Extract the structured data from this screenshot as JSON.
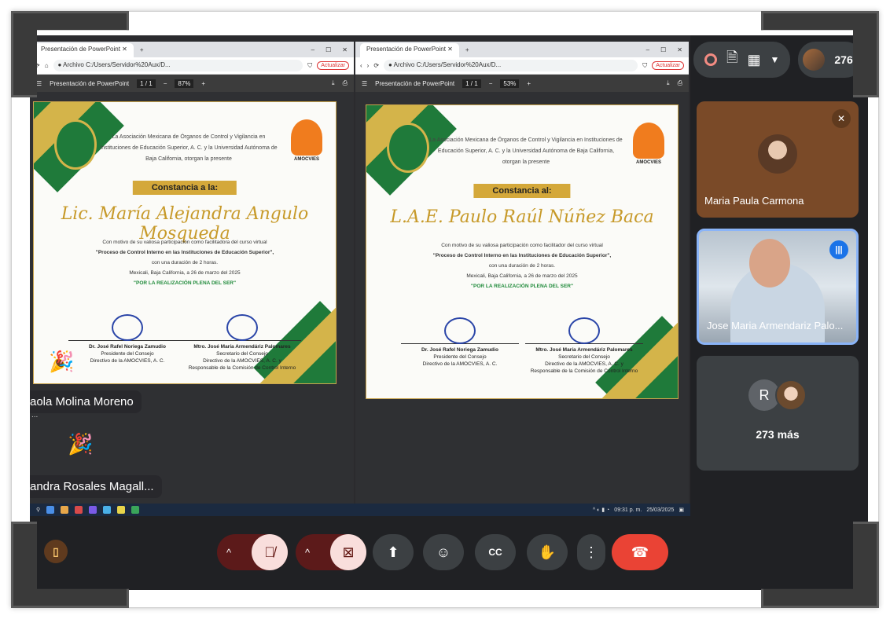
{
  "browser_left": {
    "tab_title": "Presentación de PowerPoint",
    "address_archivo": "Archivo",
    "address_path": "C:/Users/Servidor%20Aux/D...",
    "update_label": "Actualizar",
    "pdf_title": "Presentación de PowerPoint",
    "page": "1 / 1",
    "zoom": "87%"
  },
  "browser_right": {
    "tab_title": "Presentación de PowerPoint",
    "address_archivo": "Archivo",
    "address_path": "C:/Users/Servidor%20Aux/D...",
    "update_label": "Actualizar",
    "pdf_title": "Presentación de PowerPoint",
    "page": "1 / 1",
    "zoom": "53%"
  },
  "cert_left": {
    "intro": "La Asociación Mexicana de Órganos de Control y Vigilancia en Instituciones de Educación Superior, A. C. y la Universidad Autónoma de Baja California, otorgan la presente",
    "banner": "Constancia a la:",
    "recipient": "Lic. María Alejandra Angulo Mosqueda",
    "line1": "Con motivo de su valiosa participación como facilitadora del curso virtual",
    "course": "\"Proceso de Control Interno en las Instituciones de Educación Superior\",",
    "duration": "con una duración de 2 horas.",
    "place_date": "Mexicali, Baja California, a 26 de marzo del 2025",
    "motto": "\"POR LA REALIZACIÓN PLENA DEL SER\"",
    "sig1_name": "Dr. José Rafel Noriega Zamudio",
    "sig1_role1": "Presidente del Consejo",
    "sig1_role2": "Directivo de la AMOCVIES, A. C.",
    "sig2_name": "Mtro. José María Armendáriz Palomares",
    "sig2_role1": "Secretario del Consejo",
    "sig2_role2": "Directivo de la AMOCVIES, A. C. y",
    "sig2_role3": "Responsable de la Comisión de Control Interno",
    "logo_text": "AMOCVIES"
  },
  "cert_right": {
    "intro": "La Asociación Mexicana de Órganos de Control y Vigilancia en Instituciones de Educación Superior, A. C. y la Universidad Autónoma de Baja California, otorgan la presente",
    "banner": "Constancia al:",
    "recipient": "L.A.E. Paulo Raúl Núñez Baca",
    "line1": "Con motivo de su valiosa participación como facilitador del curso virtual",
    "course": "\"Proceso de Control Interno en las Instituciones de Educación Superior\",",
    "duration": "con una duración de 2 horas.",
    "place_date": "Mexicali, Baja California, a 26 de marzo del 2025",
    "motto": "\"POR LA REALIZACIÓN PLENA DEL SER\"",
    "sig1_name": "Dr. José Rafel Noriega Zamudio",
    "sig1_role1": "Presidente del Consejo",
    "sig1_role2": "Directivo de la AMOCVIES, A. C.",
    "sig2_name": "Mtro. José María Armendáriz Palomares",
    "sig2_role1": "Secretario del Consejo",
    "sig2_role2": "Directivo de la AMOCVIES, A. C. y",
    "sig2_role3": "Responsable de la Comisión de Control Interno",
    "logo_text": "AMOCVIES"
  },
  "taskbar": {
    "time": "09:31 p. m.",
    "date": "25/03/2025"
  },
  "left_labels": {
    "name1": "aola Molina Moreno",
    "name2": "andra Rosales Magall...",
    "dots": "..."
  },
  "top_controls": {
    "participant_count": "276"
  },
  "tiles": {
    "tile1_name": "Maria Paula Carmona",
    "tile2_name": "Jose Maria Armendariz Palo...",
    "tile3_initial": "R",
    "tile3_more": "273 más"
  },
  "colors": {
    "meet_bg": "#202124",
    "end_call": "#ea4335",
    "muted_bg": "#f9dedc",
    "cert_green": "#1f7a3a",
    "cert_gold": "#d4a83a",
    "speaking_blue": "#8ab4f8"
  }
}
